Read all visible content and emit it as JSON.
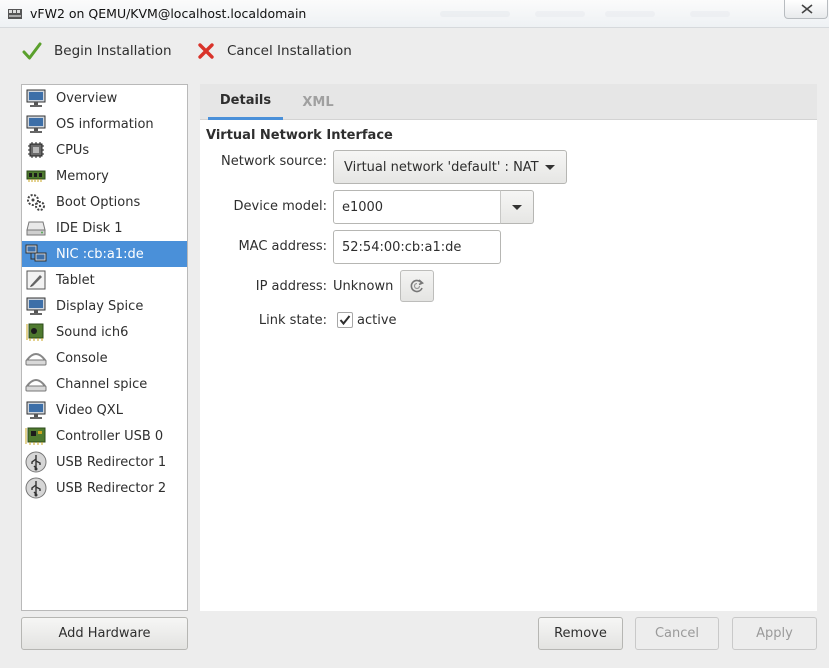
{
  "window": {
    "title": "vFW2 on QEMU/KVM@localhost.localdomain"
  },
  "toolbar": {
    "begin_label": "Begin Installation",
    "cancel_label": "Cancel Installation"
  },
  "hardware_list": {
    "items": [
      {
        "label": "Overview",
        "icon": "monitor-icon"
      },
      {
        "label": "OS information",
        "icon": "monitor-info-icon"
      },
      {
        "label": "CPUs",
        "icon": "cpu-icon"
      },
      {
        "label": "Memory",
        "icon": "memory-icon"
      },
      {
        "label": "Boot Options",
        "icon": "gears-icon"
      },
      {
        "label": "IDE Disk 1",
        "icon": "disk-icon"
      },
      {
        "label": "NIC :cb:a1:de",
        "icon": "network-icon",
        "selected": true
      },
      {
        "label": "Tablet",
        "icon": "tablet-icon"
      },
      {
        "label": "Display Spice",
        "icon": "display-icon"
      },
      {
        "label": "Sound ich6",
        "icon": "sound-card-icon"
      },
      {
        "label": "Console",
        "icon": "serial-console-icon"
      },
      {
        "label": "Channel spice",
        "icon": "channel-icon"
      },
      {
        "label": "Video QXL",
        "icon": "video-icon"
      },
      {
        "label": "Controller USB 0",
        "icon": "controller-card-icon"
      },
      {
        "label": "USB Redirector 1",
        "icon": "usb-icon"
      },
      {
        "label": "USB Redirector 2",
        "icon": "usb-icon"
      }
    ],
    "add_hardware_label": "Add Hardware"
  },
  "tabs": {
    "details": "Details",
    "xml": "XML"
  },
  "nic": {
    "section_title": "Virtual Network Interface",
    "network_source_label": "Network source:",
    "network_source_value": "Virtual network 'default' : NAT",
    "device_model_label": "Device model:",
    "device_model_value": "e1000",
    "mac_address_label": "MAC address:",
    "mac_address_value": "52:54:00:cb:a1:de",
    "ip_address_label": "IP address:",
    "ip_address_value": "Unknown",
    "link_state_label": "Link state:",
    "link_state_value": "active",
    "link_state_checked": true
  },
  "buttons": {
    "remove": "Remove",
    "cancel": "Cancel",
    "apply": "Apply"
  },
  "colors": {
    "selection": "#4a90d9",
    "begin_icon": "#5aa02c",
    "cancel_icon": "#d9332a"
  }
}
